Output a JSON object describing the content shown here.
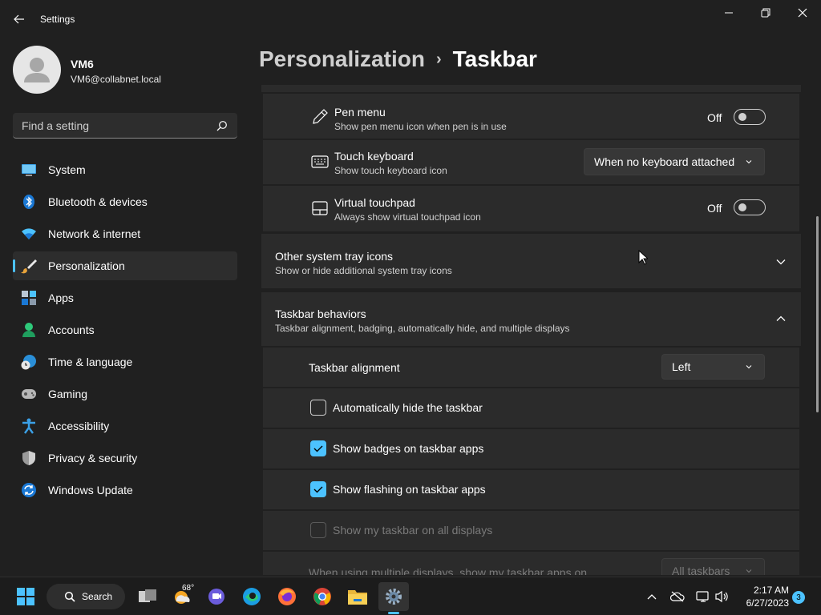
{
  "app": {
    "title": "Settings"
  },
  "user": {
    "name": "VM6",
    "email": "VM6@collabnet.local"
  },
  "search": {
    "placeholder": "Find a setting"
  },
  "nav": {
    "items": [
      {
        "label": "System"
      },
      {
        "label": "Bluetooth & devices"
      },
      {
        "label": "Network & internet"
      },
      {
        "label": "Personalization"
      },
      {
        "label": "Apps"
      },
      {
        "label": "Accounts"
      },
      {
        "label": "Time & language"
      },
      {
        "label": "Gaming"
      },
      {
        "label": "Accessibility"
      },
      {
        "label": "Privacy & security"
      },
      {
        "label": "Windows Update"
      }
    ],
    "active_index": 3
  },
  "breadcrumb": {
    "parent": "Personalization",
    "separator": "›",
    "current": "Taskbar"
  },
  "corner_icons": {
    "pen_menu": {
      "title": "Pen menu",
      "subtitle": "Show pen menu icon when pen is in use",
      "state": "Off"
    },
    "touch_keyboard": {
      "title": "Touch keyboard",
      "subtitle": "Show touch keyboard icon",
      "value": "When no keyboard attached"
    },
    "virtual_touchpad": {
      "title": "Virtual touchpad",
      "subtitle": "Always show virtual touchpad icon",
      "state": "Off"
    }
  },
  "other_tray": {
    "title": "Other system tray icons",
    "subtitle": "Show or hide additional system tray icons"
  },
  "behaviors": {
    "title": "Taskbar behaviors",
    "subtitle": "Taskbar alignment, badging, automatically hide, and multiple displays",
    "alignment_label": "Taskbar alignment",
    "alignment_value": "Left",
    "auto_hide": "Automatically hide the taskbar",
    "badges": "Show badges on taskbar apps",
    "flashing": "Show flashing on taskbar apps",
    "all_displays": "Show my taskbar on all displays",
    "multi_display_label": "When using multiple displays, show my taskbar apps on",
    "multi_display_value": "All taskbars"
  },
  "taskbar": {
    "search_label": "Search",
    "weather_temp": "68°",
    "clock_time": "2:17 AM",
    "clock_date": "6/27/2023",
    "notification_count": "3"
  },
  "colors": {
    "accent": "#4cc2ff",
    "background": "#202020",
    "card": "#2b2b2b"
  }
}
